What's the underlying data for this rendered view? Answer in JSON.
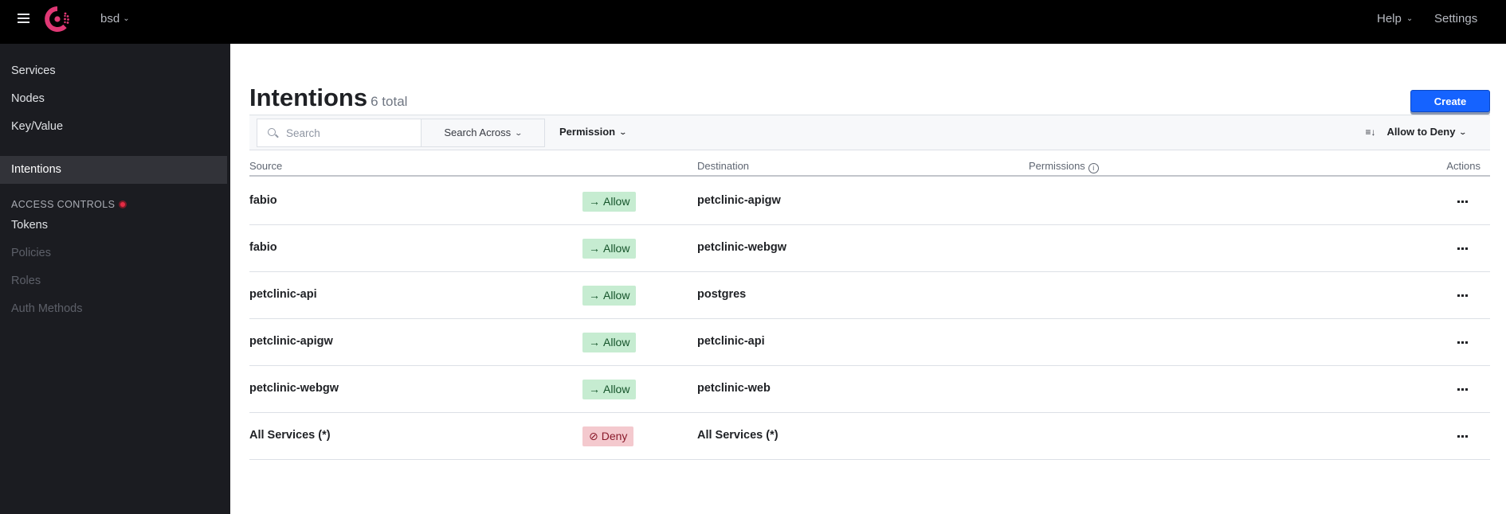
{
  "topbar": {
    "menu_icon": "hamburger-icon",
    "logo_icon": "consul-logo-icon",
    "datacenter": "bsd",
    "help_label": "Help",
    "settings_label": "Settings"
  },
  "sidebar": {
    "items": [
      {
        "label": "Services",
        "state": "normal"
      },
      {
        "label": "Nodes",
        "state": "normal"
      },
      {
        "label": "Key/Value",
        "state": "normal"
      },
      {
        "label": "Intentions",
        "state": "active"
      }
    ],
    "access_heading": "ACCESS CONTROLS",
    "access_items": [
      {
        "label": "Tokens",
        "state": "normal"
      },
      {
        "label": "Policies",
        "state": "disabled"
      },
      {
        "label": "Roles",
        "state": "disabled"
      },
      {
        "label": "Auth Methods",
        "state": "disabled"
      }
    ]
  },
  "page": {
    "title": "Intentions",
    "total": "6 total",
    "create_label": "Create"
  },
  "toolbar": {
    "search_placeholder": "Search",
    "search_value": "",
    "search_across_label": "Search Across",
    "permission_label": "Permission",
    "sort_label": "Allow to Deny"
  },
  "table": {
    "headers": {
      "source": "Source",
      "destination": "Destination",
      "permissions": "Permissions",
      "actions": "Actions"
    },
    "rows": [
      {
        "source": "fabio",
        "action": "Allow",
        "destination": "petclinic-apigw"
      },
      {
        "source": "fabio",
        "action": "Allow",
        "destination": "petclinic-webgw"
      },
      {
        "source": "petclinic-api",
        "action": "Allow",
        "destination": "postgres"
      },
      {
        "source": "petclinic-apigw",
        "action": "Allow",
        "destination": "petclinic-api"
      },
      {
        "source": "petclinic-webgw",
        "action": "Allow",
        "destination": "petclinic-web"
      },
      {
        "source": "All Services (*)",
        "action": "Deny",
        "destination": "All Services (*)"
      }
    ]
  },
  "colors": {
    "brand": "#e03875",
    "primary": "#1563ff",
    "allow_bg": "#c6ecd1",
    "deny_bg": "#f4c9ce",
    "alert_dot": "#e52c45"
  }
}
